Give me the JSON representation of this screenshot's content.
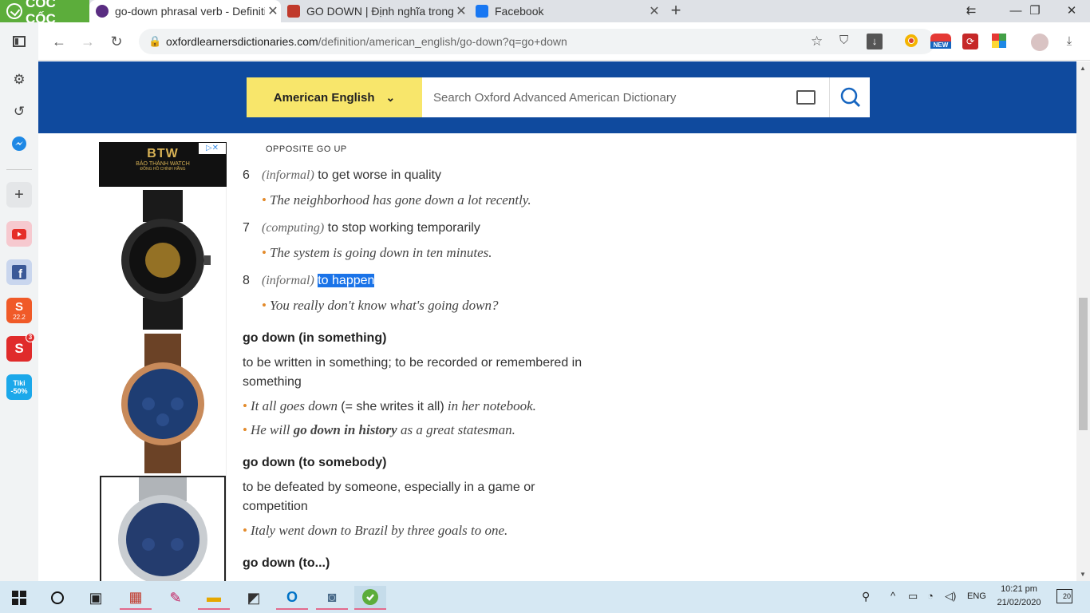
{
  "browser": {
    "brand": "CỐC CỐC",
    "tabs": [
      {
        "title": "go-down phrasal verb - Definition",
        "active": true,
        "favicon_color": "#5a2d82"
      },
      {
        "title": "GO DOWN | Định nghĩa trong",
        "active": false,
        "favicon_color": "#c0392b"
      },
      {
        "title": "Facebook",
        "active": false,
        "favicon_color": "#1877f2"
      }
    ],
    "new_tab": "+",
    "window_controls": [
      "minimize",
      "restore",
      "close"
    ],
    "url_host": "oxfordlearnersdictionaries.com",
    "url_path": "/definition/american_english/go-down?q=go+down",
    "extension_badge": "NEW"
  },
  "sidebar": {
    "items": [
      {
        "name": "sidebar-toggle-icon"
      },
      {
        "name": "settings-icon"
      },
      {
        "name": "history-icon"
      },
      {
        "name": "messenger-icon"
      },
      {
        "name": "add-icon"
      },
      {
        "name": "youtube-icon"
      },
      {
        "name": "facebook-icon"
      },
      {
        "name": "shopee-icon",
        "label": "22.2"
      },
      {
        "name": "sendo-icon",
        "badge": "3"
      },
      {
        "name": "tiki-icon",
        "label": "Tiki -50%"
      }
    ]
  },
  "oxford": {
    "language": "American English",
    "search_placeholder": "Search Oxford Advanced American Dictionary"
  },
  "ad": {
    "brand": "BẢO THÀNH WATCH",
    "tagline": "ĐỒNG HỒ CHÍNH HÃNG",
    "choice": "▷✕"
  },
  "entry": {
    "opposite": "OPPOSITE GO UP",
    "senses": [
      {
        "num": "6",
        "gram": "informal",
        "def": "to get worse in quality",
        "example": "The neighborhood has gone down a lot recently."
      },
      {
        "num": "7",
        "gram": "computing",
        "def": "to stop working temporarily",
        "example": "The system is going down in ten minutes."
      },
      {
        "num": "8",
        "gram": "informal",
        "def": "to happen",
        "example": "You really don't know what's going down?"
      }
    ],
    "phrases": [
      {
        "title": "go down (in something)",
        "def": "to be written in something; to be recorded or remembered in something",
        "ex1_a": "It all goes down",
        "ex1_b": "(= she writes it all)",
        "ex1_c": "in her notebook.",
        "ex2_a": "He will",
        "ex2_b": "go down in history",
        "ex2_c": "as a great statesman."
      },
      {
        "title": "go down (to somebody)",
        "def": "to be defeated by someone, especially in a game or competition",
        "ex1": "Italy went down to Brazil by three goals to one."
      },
      {
        "title": "go down (to...)"
      }
    ]
  },
  "taskbar": {
    "lang": "ENG",
    "time": "10:21 pm",
    "date": "21/02/2020",
    "notifications": "20"
  }
}
